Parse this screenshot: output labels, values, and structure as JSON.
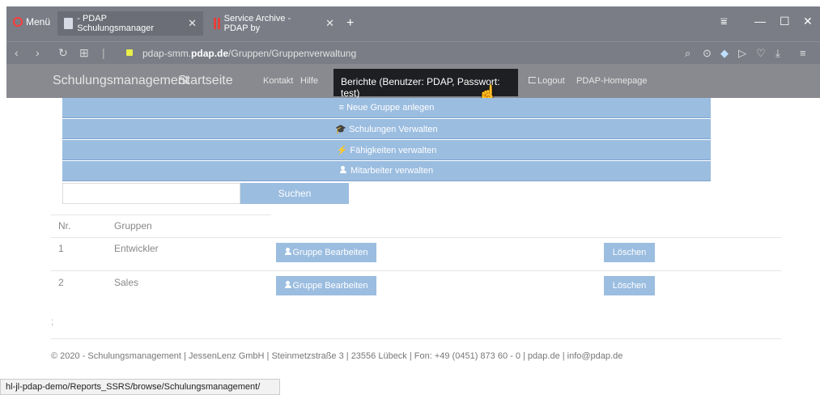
{
  "browser": {
    "menu_label": "Menü",
    "tabs": [
      {
        "label": "- PDAP Schulungsmanager",
        "active": true
      },
      {
        "label": "Service Archive - PDAP by",
        "active": false
      }
    ],
    "new_tab": "+",
    "url_prefix": "pdap-smm.",
    "url_domain": "pdap.de",
    "url_path": "/Gruppen/Gruppenverwaltung"
  },
  "nav": {
    "brand": "Schulungsmanagement",
    "home": "Startseite",
    "contact": "Kontakt",
    "help": "Hilfe",
    "reports": "Berichte (Benutzer: PDAP, Passwort: test)",
    "logout": "Logout",
    "homepage": "PDAP-Homepage"
  },
  "actions": [
    {
      "icon": "≡",
      "label": "Neue Gruppe anlegen"
    },
    {
      "icon": "🎓",
      "label": "Schulungen Verwalten"
    },
    {
      "icon": "⚡",
      "label": "Fähigkeiten verwalten"
    },
    {
      "icon": "user",
      "label": "Mitarbeiter verwalten"
    }
  ],
  "search": {
    "placeholder": "",
    "button": "Suchen"
  },
  "table": {
    "headers": [
      "Nr.",
      "Gruppen"
    ],
    "rows": [
      {
        "nr": "1",
        "name": "Entwickler",
        "edit": "Gruppe Bearbeiten",
        "delete": "Löschen"
      },
      {
        "nr": "2",
        "name": "Sales",
        "edit": "Gruppe Bearbeiten",
        "delete": "Löschen"
      }
    ],
    "trailing": ";"
  },
  "footer": "© 2020 - Schulungsmanagement | JessenLenz GmbH | Steinmetzstraße 3 | 23556 Lübeck | Fon: +49 (0451) 873 60 - 0 | pdap.de | info@pdap.de",
  "status_url": "hl-jl-pdap-demo/Reports_SSRS/browse/Schulungsmanagement/",
  "colors": {
    "accent": "#9bbde0",
    "navbar": "#888a8f",
    "chrome": "#7a7d86"
  }
}
